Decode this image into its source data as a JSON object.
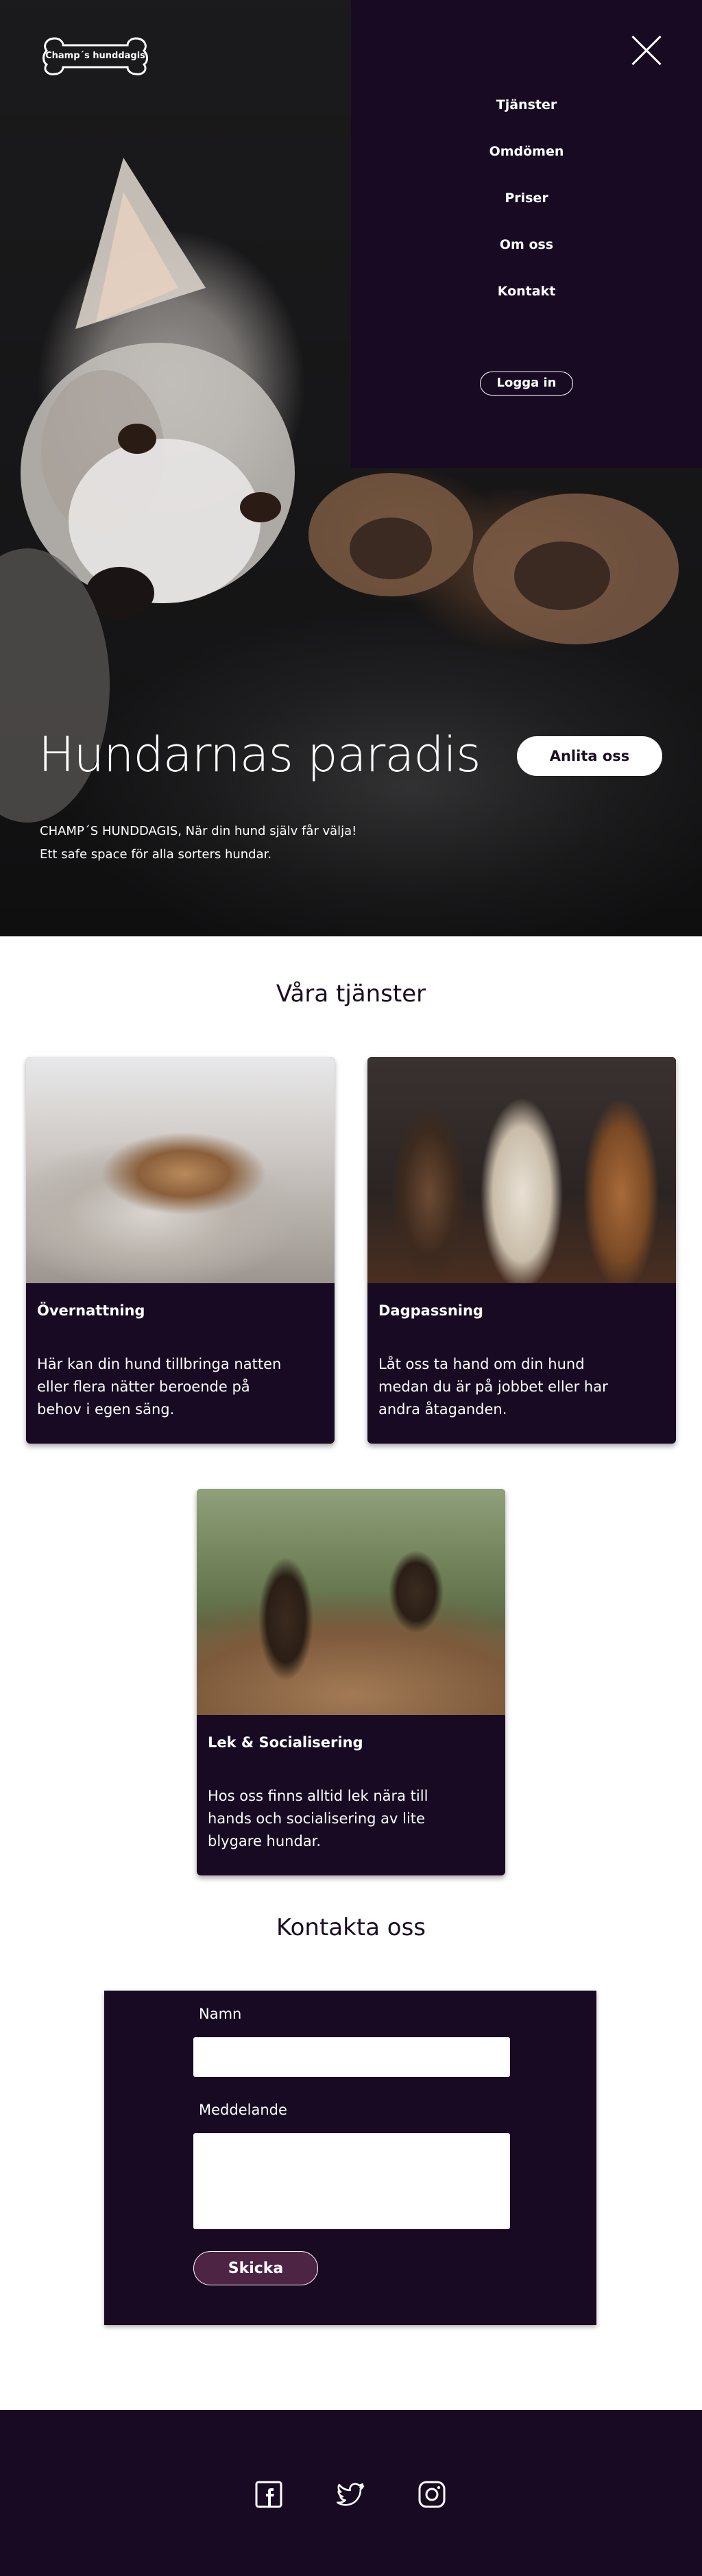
{
  "logo": {
    "text": "Champ´s hunddagis"
  },
  "nav": {
    "items": [
      "Tjänster",
      "Omdömen",
      "Priser",
      "Om oss",
      "Kontakt"
    ],
    "login_label": "Logga in"
  },
  "hero": {
    "title": "Hundarnas paradis",
    "cta_label": "Anlita oss",
    "subtitle_line1": "CHAMP´S HUNDDAGIS, När din hund själv får välja!",
    "subtitle_line2": "Ett safe space för alla sorters hundar."
  },
  "services": {
    "title": "Våra tjänster",
    "cards": [
      {
        "title": "Övernattning",
        "text": "Här kan din hund tillbringa natten eller flera nätter beroende på behov i egen säng."
      },
      {
        "title": "Dagpassning",
        "text": "Låt oss ta hand om din hund medan du är på jobbet eller har andra åtaganden."
      },
      {
        "title": "Lek & Socialisering",
        "text": "Hos oss finns alltid lek nära till hands och socialisering av lite blygare hundar."
      }
    ]
  },
  "contact": {
    "title": "Kontakta oss",
    "name_label": "Namn",
    "name_value": "",
    "message_label": "Meddelande",
    "message_value": "",
    "send_label": "Skicka"
  },
  "footer": {
    "icons": [
      "facebook-icon",
      "twitter-icon",
      "instagram-icon"
    ]
  },
  "colors": {
    "brand_dark": "#170a22",
    "button_purple": "#4e2445",
    "white": "#ffffff"
  }
}
